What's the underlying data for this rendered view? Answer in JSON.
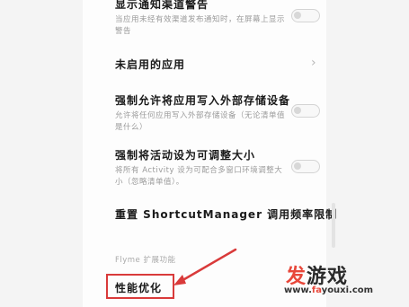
{
  "settings": {
    "items": [
      {
        "title": "显示通知渠道警告",
        "desc": [
          "当应用未经有效渠道发布通知时，在屏幕上显示",
          "警告"
        ]
      },
      {
        "title": "未启用的应用",
        "desc": []
      },
      {
        "title": "强制允许将应用写入外部存储设备",
        "desc": [
          "允许将任何应用写入外部存储设备（无论清单值",
          "是什么）"
        ]
      },
      {
        "title": "强制将活动设为可调整大小",
        "desc": [
          "将所有 Activity 设为可配合多窗口环境调整大",
          "小（忽略清单值）。"
        ]
      },
      {
        "title": "重置 ShortcutManager 调用频率限制",
        "desc": []
      }
    ],
    "section_label": "Flyme 扩展功能",
    "highlighted_item": "性能优化"
  },
  "watermark": {
    "brand_accent": "发",
    "brand_rest": "游戏",
    "url_prefix": "www.",
    "url_accent": "fa",
    "url_rest": "youxi.com"
  },
  "colors": {
    "highlight": "#d93a3a",
    "watermark_accent": "#e8473a"
  },
  "icons": {
    "chevron": "chevron-right-icon",
    "annotation": "red-arrow-annotation"
  }
}
